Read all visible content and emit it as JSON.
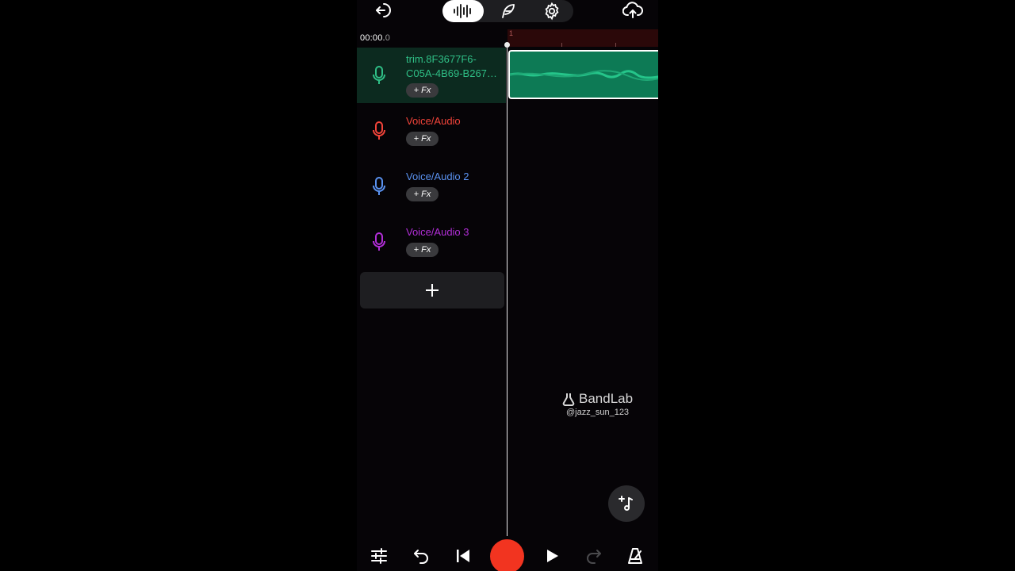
{
  "topbar": {
    "back_icon": "exit-icon",
    "tabs": [
      {
        "name": "waveform-icon",
        "active": true
      },
      {
        "name": "feather-icon",
        "active": false
      },
      {
        "name": "gear-icon",
        "active": false
      }
    ],
    "upload_icon": "cloud-upload-icon"
  },
  "timeline": {
    "time_main": "00:00.",
    "time_ms": "0",
    "ruler_label": "1"
  },
  "tracks": [
    {
      "name": "trim.8F3677F6-C05A-4B69-B267…",
      "fx": "+ Fx",
      "color": "#2fbf86",
      "selected": true
    },
    {
      "name": "Voice/Audio",
      "fx": "+ Fx",
      "color": "#f2443a",
      "selected": false
    },
    {
      "name": "Voice/Audio 2",
      "fx": "+ Fx",
      "color": "#5a92f0",
      "selected": false
    },
    {
      "name": "Voice/Audio 3",
      "fx": "+ Fx",
      "color": "#b22ed8",
      "selected": false
    }
  ],
  "watermark": {
    "brand": "BandLab",
    "handle": "@jazz_sun_123"
  },
  "bottombar": {
    "icons": [
      "mixer-sliders-icon",
      "undo-icon",
      "skip-to-start-icon",
      "record-button",
      "play-icon",
      "redo-icon",
      "metronome-icon"
    ]
  },
  "colors": {
    "accent_green": "#0d7a55",
    "record_red": "#f23420",
    "ruler_bg": "#2b0809"
  }
}
